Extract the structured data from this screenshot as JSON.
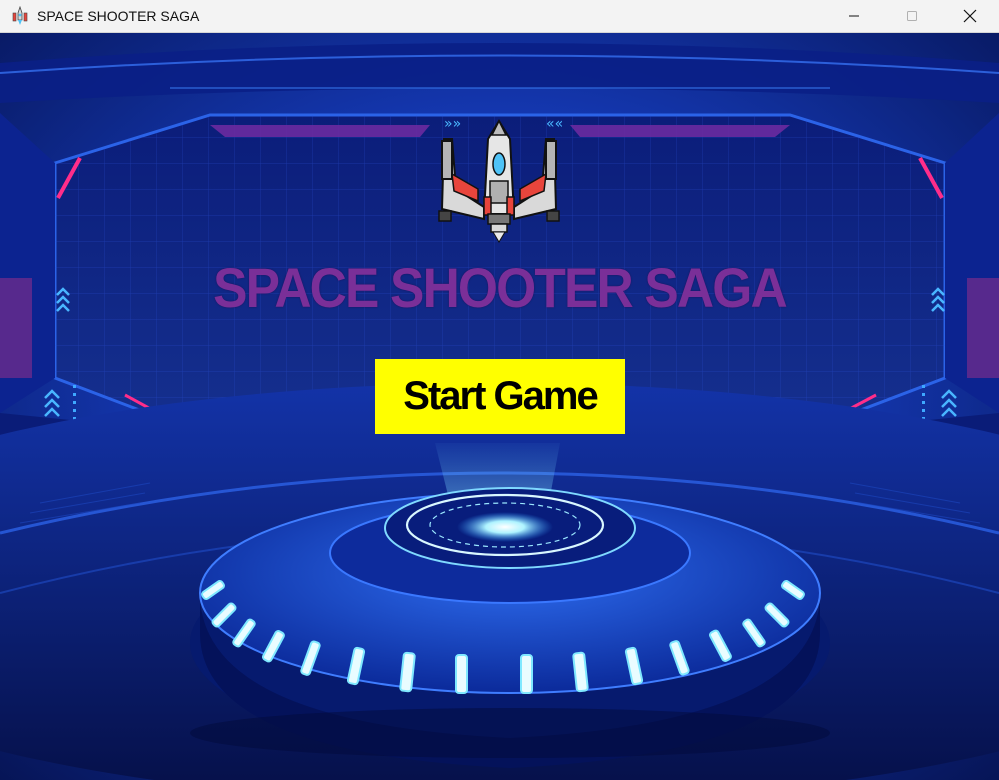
{
  "window": {
    "title": "SPACE SHOOTER SAGA",
    "controls": {
      "minimize": "minimize",
      "maximize": "maximize",
      "close": "close"
    }
  },
  "game": {
    "title": "SPACE SHOOTER SAGA",
    "start_button_label": "Start Game",
    "title_color": "#7a2f98",
    "button_color": "#ffff00"
  },
  "icons": {
    "app": "spaceship-icon",
    "hero": "spaceship-icon",
    "minimize": "minimize-icon",
    "maximize": "maximize-icon",
    "close": "close-icon"
  },
  "colors": {
    "background_dark": "#06124f",
    "background_mid": "#1436b8",
    "glow": "#7fe8ff",
    "accent_pink": "#ff2d8a"
  }
}
